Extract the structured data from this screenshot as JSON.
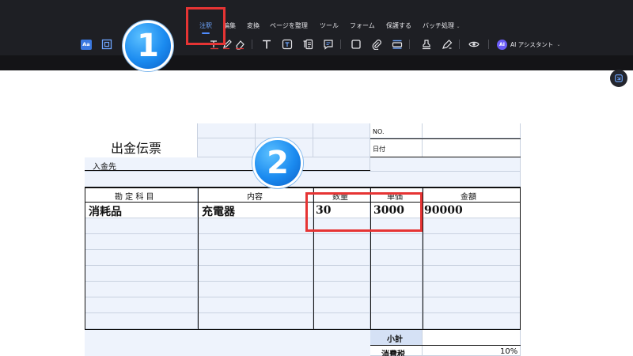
{
  "menu": {
    "items": [
      "注釈",
      "編集",
      "変換",
      "ページを整理",
      "ツール",
      "フォーム",
      "保護する",
      "バッチ処理"
    ],
    "active_index": 0
  },
  "toolbar": {
    "text_tool_label": "Aa",
    "ai_badge": "AI",
    "ai_label": "AI アシスタント",
    "icons": [
      "text-highlight-icon",
      "frame-icon",
      "text-icon",
      "pen-icon",
      "eraser-icon",
      "text-tool-icon",
      "textbox-icon",
      "callout-icon",
      "comment-icon",
      "rectangle-icon",
      "paperclip-icon",
      "stamp-bar-icon",
      "stamp-icon",
      "signature-icon",
      "eye-icon"
    ]
  },
  "overlays": {
    "badge_1": "1",
    "badge_2": "2",
    "colors": {
      "highlight_red": "#e63434",
      "badge_blue": "#1b8bf0"
    }
  },
  "form": {
    "title": "出金伝票",
    "payee_label": "入金先",
    "no_label": "NO.",
    "date_label": "日付",
    "columns": [
      "勘 定 科 目",
      "内容",
      "数量",
      "単価",
      "金額"
    ],
    "rows": [
      {
        "account": "消耗品",
        "content": "充電器",
        "quantity": "30",
        "unit_price": "3000",
        "amount": "90000"
      }
    ],
    "subtotal_label": "小計",
    "tax_label": "消費税",
    "tax_rate": "10%"
  }
}
